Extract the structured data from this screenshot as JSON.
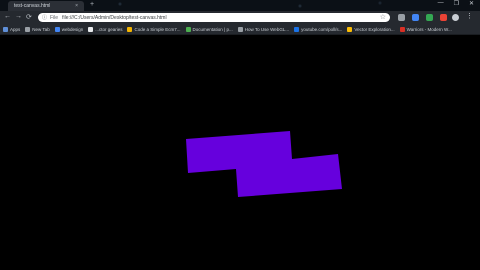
{
  "tab": {
    "title": "test-canvas.html",
    "close": "×"
  },
  "newtab": "+",
  "window_controls": [
    "—",
    "❐",
    "✕"
  ],
  "nav": {
    "back": "←",
    "forward": "→",
    "reload": "⟳"
  },
  "omnibox": {
    "scheme": "File",
    "url": "file:///C:/Users/Admin/Desktop/test-canvas.html"
  },
  "bookmarks": [
    {
      "label": "Apps",
      "color": "#5f8fd8"
    },
    {
      "label": "New Tab",
      "color": "#9aa0a6"
    },
    {
      "label": "webdesign",
      "color": "#4285f4"
    },
    {
      "label": "...ctor gearies",
      "color": "#e8eaed"
    },
    {
      "label": "Code a Simple Ecm7...",
      "color": "#f4b400"
    },
    {
      "label": "Documentation | p...",
      "color": "#4caf50"
    },
    {
      "label": "How To Use WebGL...",
      "color": "#9aa0a6"
    },
    {
      "label": "youtube.com/poll/s...",
      "color": "#1a73e8"
    },
    {
      "label": "Vector Exploration...",
      "color": "#fbbc04"
    },
    {
      "label": "Warriors - Modern W...",
      "color": "#d93025"
    }
  ],
  "canvas": {
    "fill": "#6600dd",
    "background": "#000000"
  }
}
